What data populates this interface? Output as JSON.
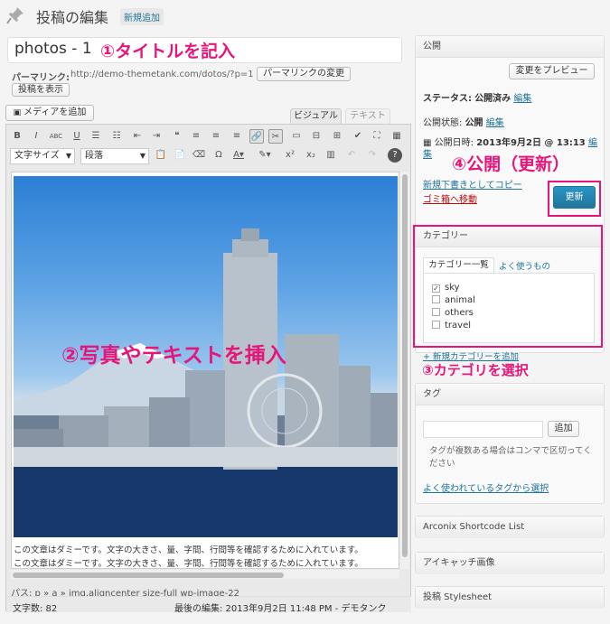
{
  "header": {
    "title": "投稿の編集",
    "add_new": "新規追加"
  },
  "post": {
    "title_value": "photos - 1",
    "permalink_label": "パーマリンク:",
    "permalink_url": "http://demo-themetank.com/dotos/?p=1",
    "permalink_change": "パーマリンクの変更",
    "view_post": "投稿を表示"
  },
  "editor": {
    "add_media": "メディアを追加",
    "tab_visual": "ビジュアル",
    "tab_text": "テキスト",
    "format_select": "文字サイズ",
    "paragraph_select": "段落",
    "body_line1": "この文章はダミーです。文字の大きさ、量、字間、行間等を確認するために入れています。",
    "body_line2": "この文章はダミーです。文字の大きさ、量、字間、行間等を確認するために入れています。",
    "path": "パス: p » a » img.aligncenter size-full wp-image-22",
    "word_count": "文字数: 82",
    "last_edit": "最後の編集: 2013年9月2日 11:48 PM - デモタンク"
  },
  "annotations": {
    "a1": "①タイトルを記入",
    "a2": "②写真やテキストを挿入",
    "a3": "③カテゴリを選択",
    "a4": "④公開（更新）"
  },
  "publish": {
    "heading": "公開",
    "preview": "変更をプレビュー",
    "status_label": "ステータス:",
    "status_value": "公開済み",
    "status_edit": "編集",
    "visibility_label": "公開状態:",
    "visibility_value": "公開",
    "visibility_edit": "編集",
    "date_label": "公開日時:",
    "date_value": "2013年9月2日 @ 13:13",
    "date_edit": "編集",
    "copy_draft": "新規下書きとしてコピー",
    "trash": "ゴミ箱へ移動",
    "update": "更新"
  },
  "categories": {
    "heading": "カテゴリー",
    "tab_all": "カテゴリー一覧",
    "tab_popular": "よく使うもの",
    "items": [
      {
        "label": "sky",
        "checked": true
      },
      {
        "label": "animal",
        "checked": false
      },
      {
        "label": "others",
        "checked": false
      },
      {
        "label": "travel",
        "checked": false
      }
    ],
    "add_new": "+ 新規カテゴリーを追加"
  },
  "tags": {
    "heading": "タグ",
    "add": "追加",
    "help": "タグが複数ある場合はコンマで区切ってください",
    "often": "よく使われているタグから選択"
  },
  "panels": {
    "arconix": "Arconix Shortcode List",
    "eyecatch": "アイキャッチ画像",
    "stylesheet": "投稿 Stylesheet"
  },
  "colors": {
    "annotation": "#e6157a",
    "link": "#21759b",
    "primary": "#21759b"
  }
}
